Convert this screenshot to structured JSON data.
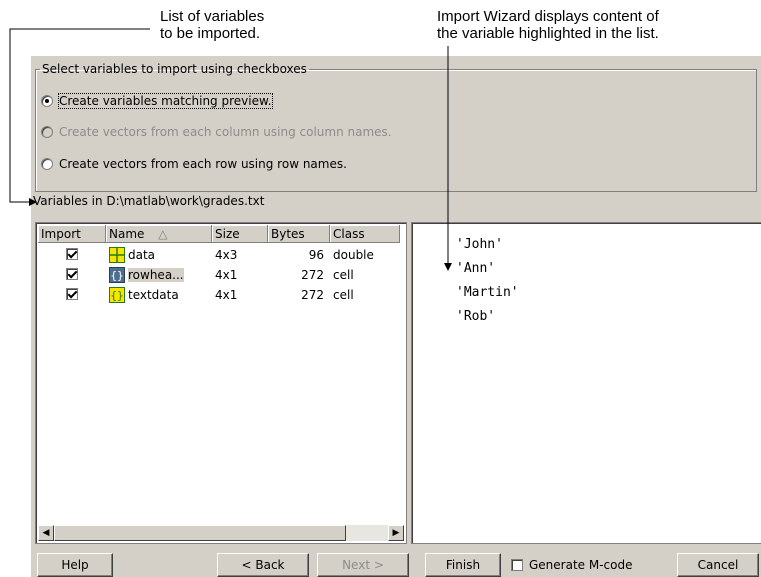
{
  "callouts": {
    "left": [
      "List of variables",
      "to be imported."
    ],
    "right": [
      "Import Wizard displays content of",
      "the variable highlighted in the list."
    ]
  },
  "group": {
    "legend": "Select variables to import using checkboxes",
    "options": [
      {
        "label": "Create variables matching preview.",
        "selected": true,
        "enabled": true
      },
      {
        "label": "Create vectors from each column using column names.",
        "selected": false,
        "enabled": false
      },
      {
        "label": "Create vectors from each row using row names.",
        "selected": false,
        "enabled": true
      }
    ]
  },
  "variables_label": "Variables in D:\\matlab\\work\\grades.txt",
  "table": {
    "columns": [
      "Import",
      "Name",
      "Size",
      "Bytes",
      "Class"
    ],
    "sort_indicator": "△",
    "rows": [
      {
        "checked": true,
        "icon": "matrix-icon",
        "name": "data",
        "size": "4x3",
        "bytes": "96",
        "class": "double"
      },
      {
        "checked": true,
        "icon": "cell-array-icon",
        "name": "rowhea...",
        "size": "4x1",
        "bytes": "272",
        "class": "cell"
      },
      {
        "checked": true,
        "icon": "cell-array-icon",
        "name": "textdata",
        "size": "4x1",
        "bytes": "272",
        "class": "cell"
      }
    ]
  },
  "preview": [
    "'John'",
    "'Ann'",
    "'Martin'",
    "'Rob'"
  ],
  "buttons": {
    "help": "Help",
    "back": "< Back",
    "next": "Next >",
    "finish": "Finish",
    "generate": "Generate M-code",
    "cancel": "Cancel"
  },
  "colors": {
    "dialog_bg": "#d4d0c8",
    "matrix_icon": "#f4e600",
    "cell_icon_bg": "#4d6f8f"
  }
}
